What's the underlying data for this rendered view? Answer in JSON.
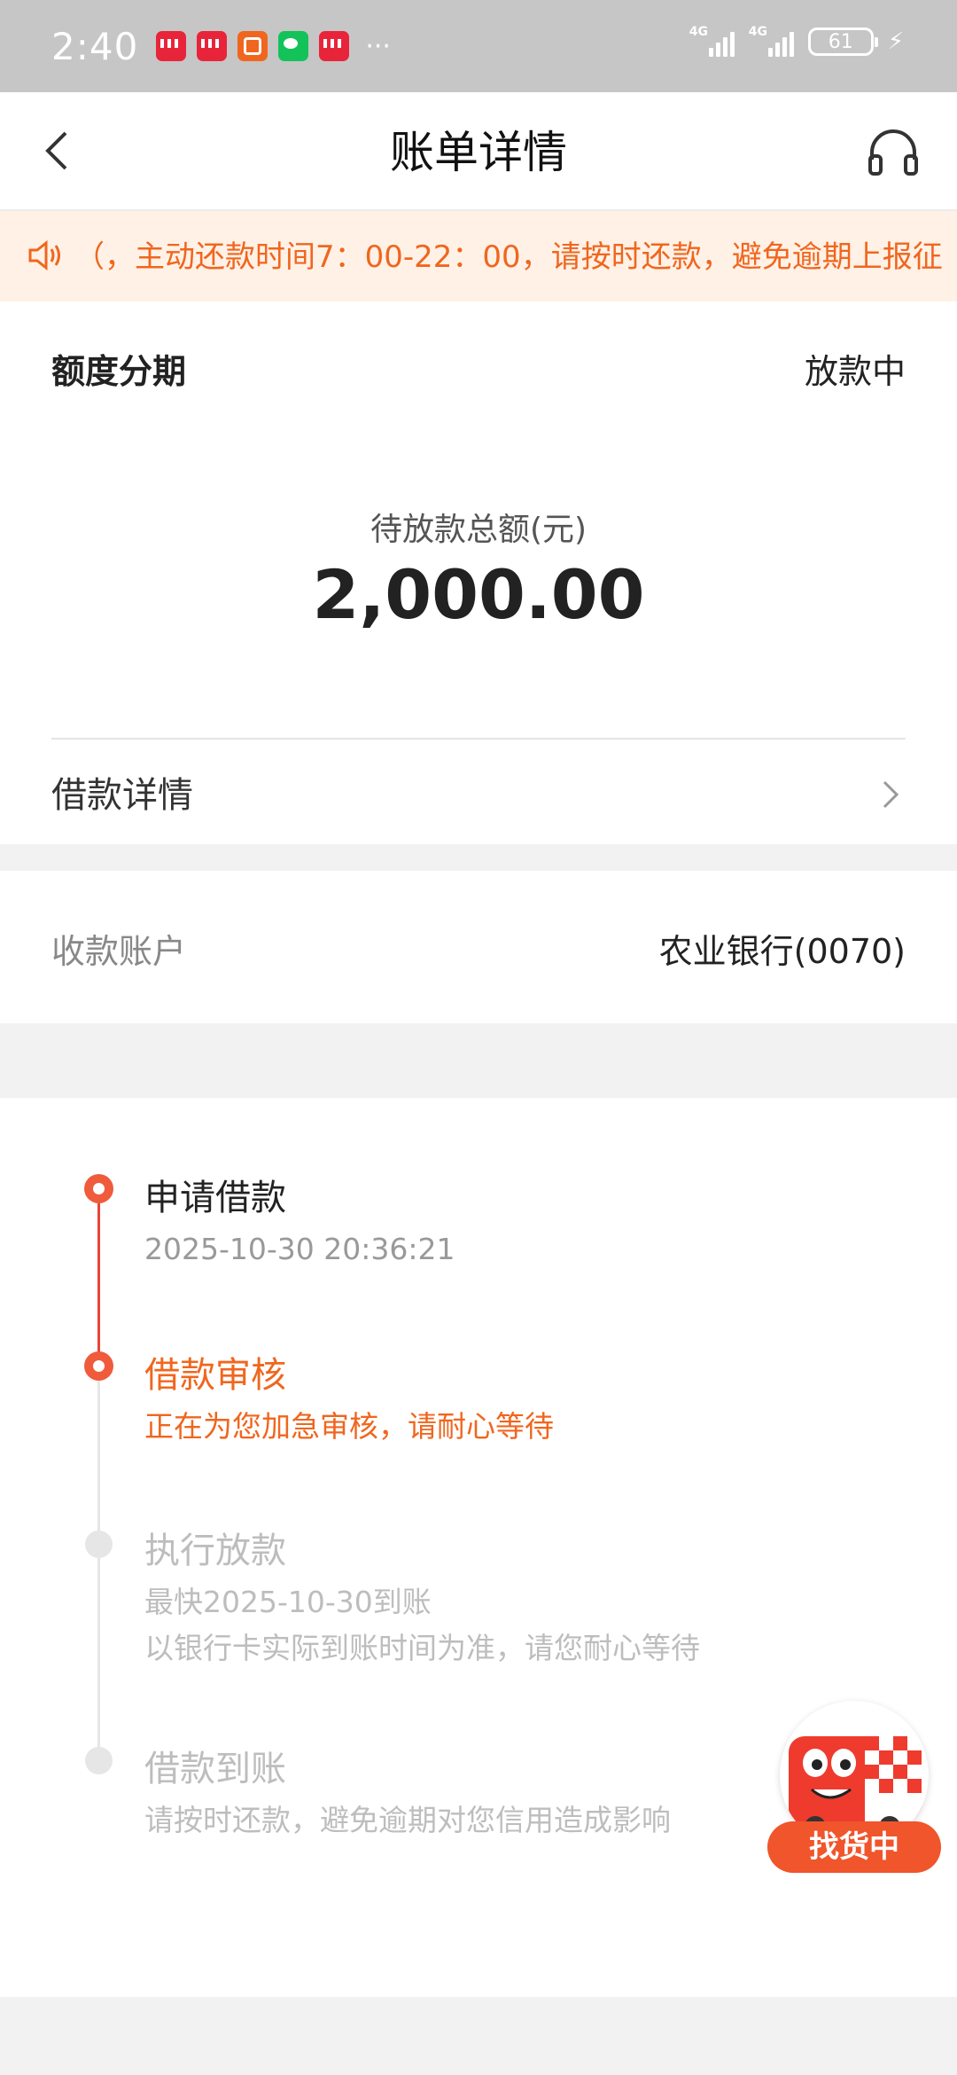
{
  "status_bar": {
    "time": "2:40",
    "app_icons": [
      "red-app-icon",
      "red-app-icon",
      "orange-app-icon",
      "wechat-icon",
      "red-app-icon"
    ],
    "more": "···",
    "signal1_label": "4G",
    "signal2_label": "4G",
    "battery": "61"
  },
  "nav": {
    "title": "账单详情"
  },
  "notice": {
    "text": "（，主动还款时间7：00-22：00，请按时还款，避免逾期上报征"
  },
  "summary": {
    "product": "额度分期",
    "status": "放款中",
    "amount_label": "待放款总额(元)",
    "amount": "2,000.00",
    "detail_link": "借款详情"
  },
  "account": {
    "label": "收款账户",
    "value": "农业银行(0070)"
  },
  "timeline": {
    "steps": [
      {
        "title": "申请借款",
        "lines": [
          "2025-10-30 20:36:21"
        ]
      },
      {
        "title": "借款审核",
        "lines": [
          "正在为您加急审核，请耐心等待"
        ]
      },
      {
        "title": "执行放款",
        "lines": [
          "最快2025-10-30到账",
          "以银行卡实际到账时间为准，请您耐心等待"
        ]
      },
      {
        "title": "借款到账",
        "lines": [
          "请按时还款，避免逾期对您信用造成影响"
        ]
      }
    ]
  },
  "float_badge": {
    "label": "找货中"
  },
  "colors": {
    "accent": "#f0661e",
    "timeline_red": "#e8443a",
    "status_bar": "#c6c6c6"
  }
}
